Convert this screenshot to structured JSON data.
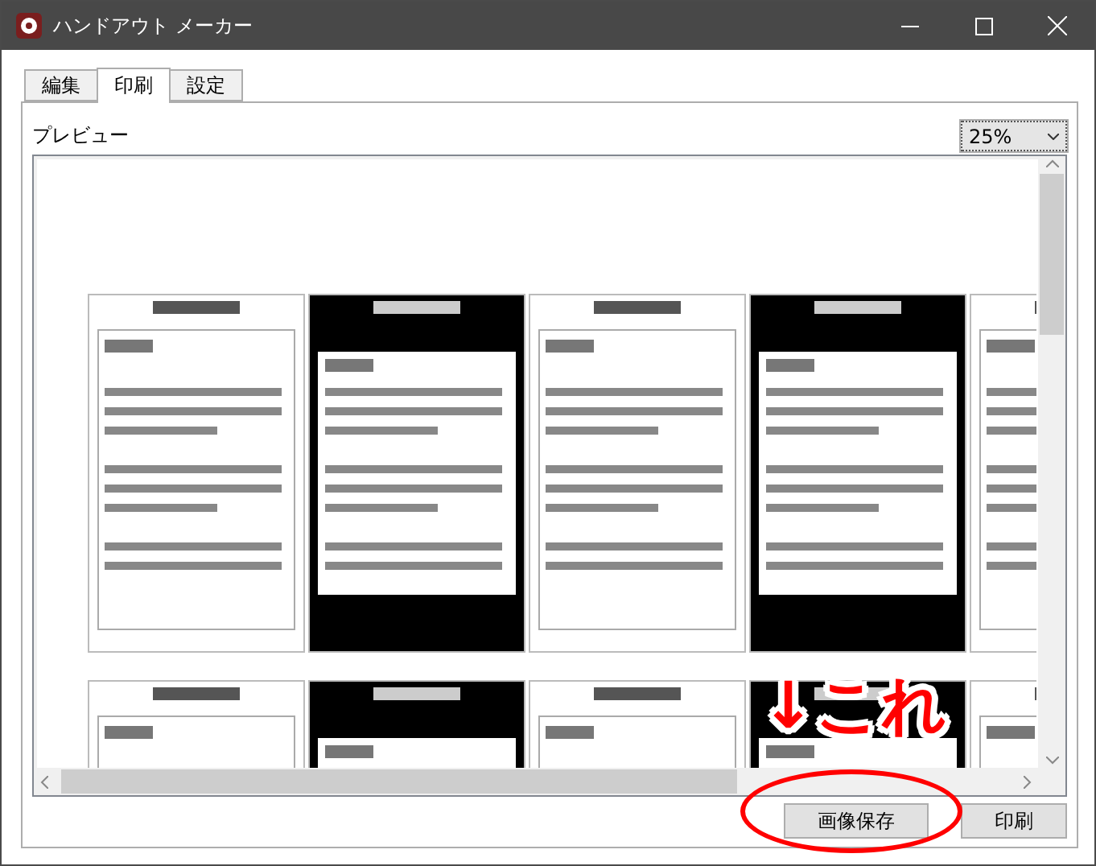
{
  "window": {
    "title": "ハンドアウト メーカー"
  },
  "tabs": [
    {
      "label": "編集",
      "selected": false
    },
    {
      "label": "印刷",
      "selected": true
    },
    {
      "label": "設定",
      "selected": false
    }
  ],
  "preview": {
    "label": "プレビュー",
    "zoom": "25%"
  },
  "annotation": {
    "text": "↓これ"
  },
  "buttons": [
    {
      "label": "画像保存",
      "highlighted": true
    },
    {
      "label": "印刷",
      "highlighted": false
    }
  ]
}
